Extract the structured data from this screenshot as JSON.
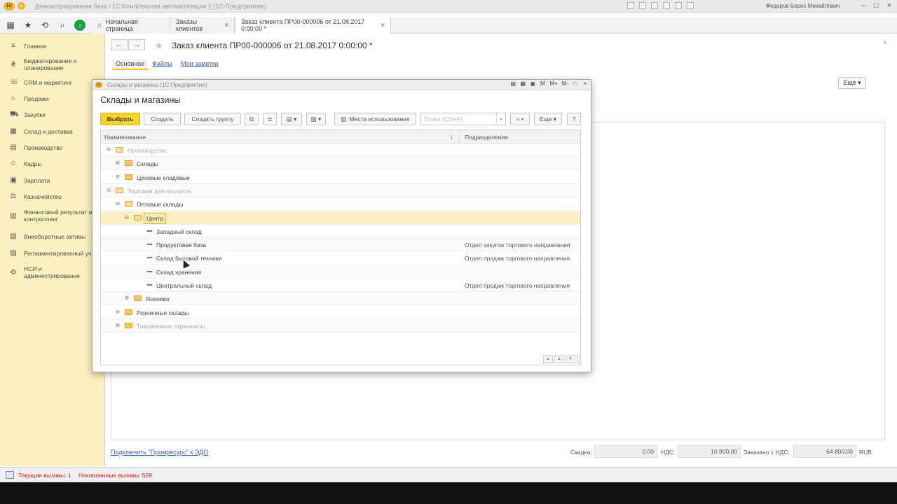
{
  "window": {
    "title": "Демонстрационная база / 1С:Комплексная автоматизация 2  (1С:Предприятие)",
    "user": "Федоров Борис Михайлович",
    "logo_text": "1С"
  },
  "tabs": [
    {
      "label": "Начальная страница"
    },
    {
      "label": "Заказы клиентов",
      "close": "×"
    },
    {
      "label": "Заказ клиента ПР00-000006 от 21.08.2017 0:00:00 *",
      "close": "×"
    }
  ],
  "sidebar": {
    "items": [
      {
        "icon": "menu-icon",
        "glyph": "≡",
        "label": "Главное"
      },
      {
        "icon": "budget-icon",
        "glyph": "₴",
        "label": "Бюджетирование и\nпланирование"
      },
      {
        "icon": "crm-icon",
        "glyph": "☏",
        "label": "CRM и маркетинг"
      },
      {
        "icon": "sales-icon",
        "glyph": "⌂",
        "label": "Продажи"
      },
      {
        "icon": "cart-icon",
        "glyph": "⛟",
        "label": "Закупки"
      },
      {
        "icon": "warehouse-icon",
        "glyph": "▦",
        "label": "Склад и доставка"
      },
      {
        "icon": "production-icon",
        "glyph": "▤",
        "label": "Производство"
      },
      {
        "icon": "staff-icon",
        "glyph": "☺",
        "label": "Кадры"
      },
      {
        "icon": "salary-icon",
        "glyph": "▣",
        "label": "Зарплата"
      },
      {
        "icon": "treasury-icon",
        "glyph": "⚖",
        "label": "Казначейство"
      },
      {
        "icon": "finance-icon",
        "glyph": "▥",
        "label": "Финансовый результат и\nконтроллинг"
      },
      {
        "icon": "assets-icon",
        "glyph": "▧",
        "label": "Внеоборотные активы"
      },
      {
        "icon": "reports-icon",
        "glyph": "▨",
        "label": "Регламентированный уч..."
      },
      {
        "icon": "settings-icon",
        "glyph": "⚙",
        "label": "НСИ и\nадминистрирование"
      }
    ]
  },
  "form": {
    "title": "Заказ клиента ПР00-000006 от 21.08.2017 0:00:00 *",
    "tabs": [
      "Основное",
      "Файлы",
      "Мои заметки"
    ],
    "more_label": "Еще ▾",
    "edo_link": "Подключить \"Промресурс\" к ЭДО",
    "totals": {
      "discount_label": "Скидка:",
      "discount_value": "0,00",
      "vat_label": "НДС:",
      "vat_value": "10 800,00",
      "ordered_label": "Заказано с НДС:",
      "ordered_value": "64 800,00",
      "currency": "RUB"
    }
  },
  "dialog": {
    "window_title": "Склады и магазины  (1С:Предприятие)",
    "heading": "Склады и магазины",
    "buttons": {
      "select": "Выбрать",
      "create": "Создать",
      "create_group": "Создать группу",
      "usage": "Места использования",
      "more": "Еще ▾",
      "help": "?"
    },
    "search_placeholder": "Поиск (Ctrl+F)",
    "columns": {
      "name": "Наименование",
      "dept": "Подразделение"
    },
    "rows": [
      {
        "name": "Производство",
        "dept": "",
        "level": 0,
        "kind": "folder",
        "exp": "⊖",
        "grey": true
      },
      {
        "name": "Склады",
        "dept": "",
        "level": 1,
        "kind": "folder",
        "exp": "⊕",
        "grey": false
      },
      {
        "name": "Цеховые кладовые",
        "dept": "",
        "level": 1,
        "kind": "folder",
        "exp": "⊕",
        "grey": false
      },
      {
        "name": "Торговая деятельность",
        "dept": "",
        "level": 0,
        "kind": "folder",
        "exp": "⊖",
        "grey": true
      },
      {
        "name": "Оптовые склады",
        "dept": "",
        "level": 1,
        "kind": "folder",
        "exp": "⊖",
        "grey": false
      },
      {
        "name": "Центр",
        "dept": "",
        "level": 2,
        "kind": "folder",
        "exp": "⊖",
        "grey": false,
        "selected": true
      },
      {
        "name": "Западный склад",
        "dept": "",
        "level": 3,
        "kind": "item",
        "grey": false
      },
      {
        "name": "Продуктовая база",
        "dept": "Отдел закупок торгового направления",
        "level": 3,
        "kind": "item",
        "grey": false
      },
      {
        "name": "Склад бытовой техники",
        "dept": "Отдел продаж торгового направления",
        "level": 3,
        "kind": "item",
        "grey": false
      },
      {
        "name": "Склад хранения",
        "dept": "",
        "level": 3,
        "kind": "item",
        "grey": false
      },
      {
        "name": "Центральный склад",
        "dept": "Отдел продаж торгового направления",
        "level": 3,
        "kind": "item",
        "grey": false
      },
      {
        "name": "Ясенево",
        "dept": "",
        "level": 2,
        "kind": "folder",
        "exp": "⊕",
        "grey": false
      },
      {
        "name": "Розничные склады",
        "dept": "",
        "level": 1,
        "kind": "folder",
        "exp": "⊕",
        "grey": false
      },
      {
        "name": "Таможенные терминалы",
        "dept": "",
        "level": 1,
        "kind": "folder",
        "exp": "⊕",
        "grey": true
      }
    ]
  },
  "status": {
    "current_calls": "Текущие вызовы: 1",
    "accumulated_calls": "Накопленные вызовы: 509"
  }
}
